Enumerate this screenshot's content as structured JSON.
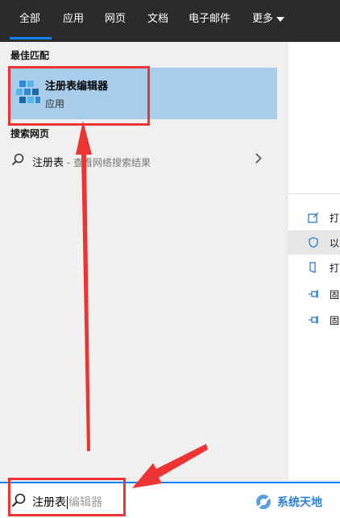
{
  "tabs": [
    "全部",
    "应用",
    "网页",
    "文档",
    "电子邮件",
    "更多"
  ],
  "best_match": {
    "heading": "最佳匹配",
    "title": "注册表编辑器",
    "subtitle": "应用",
    "icon": "registry-editor-icon"
  },
  "web": {
    "heading": "搜索网页",
    "query": "注册表",
    "suffix": " - 查看网络搜索结果"
  },
  "actions": [
    {
      "label": "打",
      "icon": "open-icon"
    },
    {
      "label": "以",
      "icon": "shield-icon"
    },
    {
      "label": "打",
      "icon": "file-location-icon"
    },
    {
      "label": "固",
      "icon": "pin-icon"
    },
    {
      "label": "固",
      "icon": "pin-icon"
    }
  ],
  "search": {
    "typed": "注册表",
    "suggestion": "编辑器"
  },
  "watermark": "系统天地",
  "colors": {
    "accent": "#0a84ff",
    "selection": "#a7cdea",
    "annotation": "#ee3333"
  }
}
